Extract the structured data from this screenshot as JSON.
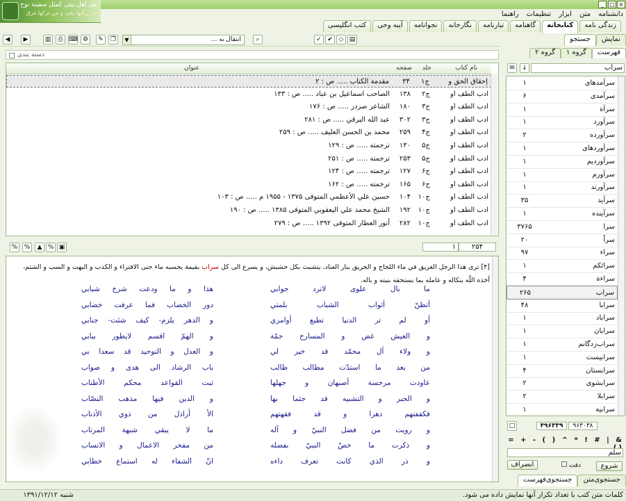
{
  "logo": {
    "line1": "مل اهل بیتی کمثل سفینة نوح",
    "line2": "من رکبها نجی و من",
    "line3": "ترکها غرق"
  },
  "menu": [
    "دانشنامه",
    "متن",
    "ابزار",
    "تنظیمات",
    "راهنما"
  ],
  "top_tabs": [
    "زندگی نامه",
    "کتابخانه",
    "گاهنامه",
    "تبارنامه",
    "نگارخانه",
    "نجوانامه",
    "آینه وحی",
    "کتب انگلیسی"
  ],
  "side_tabs": [
    "نمایش",
    "جستجو"
  ],
  "jump_label": "انتقال به ...",
  "category_label": "دسته بندی",
  "columns": {
    "book": "نام کتاب",
    "vol": "جلد",
    "page": "صفحه",
    "title": "عنوان"
  },
  "results": [
    {
      "book": "إحقاق الحق و ...",
      "vol": "ج۱",
      "page": "۳۴",
      "title": "مقدمة الكتاب ..... ص : ۲"
    },
    {
      "book": "ادب الطف أو ...",
      "vol": "ج۲",
      "page": "۱۳۸",
      "title": "الصاحب اسماعيل بن عباد ..... ص : ۱۳۳"
    },
    {
      "book": "ادب الطف أو ...",
      "vol": "ج۳",
      "page": "۱۸۰",
      "title": "الشاعر صردر ..... ص : ۱۷۶"
    },
    {
      "book": "ادب الطف أو ...",
      "vol": "ج۳",
      "page": "۳۰۲",
      "title": "عبد الله البرقي ..... ص : ۲۸۱"
    },
    {
      "book": "ادب الطف أو ...",
      "vol": "ج۴",
      "page": "۲۵۹",
      "title": "محمد بن الحسن العليف ..... ص : ۲۵۹"
    },
    {
      "book": "ادب الطف أو ...",
      "vol": "ج۵",
      "page": "۱۳۰",
      "title": "ترجمته ..... ص : ۱۲۹"
    },
    {
      "book": "ادب الطف أو ...",
      "vol": "ج۵",
      "page": "۲۵۳",
      "title": "ترجمته ..... ص : ۲۵۱"
    },
    {
      "book": "ادب الطف أو ...",
      "vol": "ج۶",
      "page": "۱۲۷",
      "title": "ترجمته ..... ص : ۱۲۴"
    },
    {
      "book": "ادب الطف أو ...",
      "vol": "ج۶",
      "page": "۱۶۵",
      "title": "ترجمته ..... ص : ۱۶۲"
    },
    {
      "book": "ادب الطف أو ...",
      "vol": "ج۱۰",
      "page": "۱۰۴",
      "title": "حسين علي الأعظمي المتوفى ۱۳۷۵ - ۱۹۵۵ م ..... ص : ۱۰۳"
    },
    {
      "book": "ادب الطف أو ...",
      "vol": "ج۱۰",
      "page": "۱۹۲",
      "title": "الشيخ محمد علي اليعقوبي المتوفى ۱۳۸۵ ..... ص : ۱۹۰"
    },
    {
      "book": "ادب الطف أو ...",
      "vol": "ج۱۰",
      "page": "۲۸۲",
      "title": "أنور العطار المتوفى ۱۳۹۲ ..... ص : ۲۷۹"
    }
  ],
  "pager": {
    "current": "۱",
    "total": "۲۵۴"
  },
  "prose": {
    "before": "[۴] ترى هذا الرجل الغريق في ماء اللجاج و الحريق بنار العناد، يتشبث بكل حشيش، و يسرع الى كل ",
    "highlight": "سراب",
    "after": " بقيمة يحسبه ماء حتى الافتراء و الكذب و البهت و السب و الشتم، أخذه اللّه بنكاله و عامله بما يستحقه بنيته و باله."
  },
  "poem": [
    [
      "ما بال علوى لاترد جوابي",
      "هذا و ما ودعت شرخ شبابي"
    ],
    [
      "أتظنّ أثواب الشباب بلمتي",
      "دور الخضاب فما عرفت خضابي"
    ],
    [
      "أو لم تر الدنيا تطيع أوامري",
      "و الدهر يلزم- كيف شئت- جنابي"
    ],
    [
      "و العيش غض و المسارح جمّة",
      "و الهمّ اقسم لايطور ببابي"
    ],
    [
      "و ولاء آل محمّد قد خير لي",
      "و العدل و التوحيد قد سعدا بي"
    ],
    [
      "من بعد ما استدّت مطالب طالب",
      "باب الرشاد الى هدى و صواب"
    ],
    [
      "عاودت مرجسة أصبهان و جهلها",
      "ثبت القواعد محكم الأطناب"
    ],
    [
      "و الجبر و التشبيه قد جثما بها",
      "و الدين فيها مذهب النصّاب"
    ],
    [
      "فكففتهم دهرا و قد فقهتهم",
      "الأ أراذل من ذوي الأذناب"
    ],
    [
      "و رويت من فضل النبيّ و آله",
      "ما لا يبقي شبهة المرتاب"
    ],
    [
      "و ذكرت ما خصّ النبيّ بفضله",
      "من مفخر الاعمال و الانساب"
    ],
    [
      "و ذر الذي كانت تعرف داءه",
      "انّ الشفاء له استماع خطابي"
    ]
  ],
  "group_tabs": [
    "فهرست",
    "گروه ۱",
    "گروه ۲"
  ],
  "search_value": "سراب",
  "words": [
    {
      "t": "سرآمدهای",
      "c": "۱"
    },
    {
      "t": "سرآمدی",
      "c": "۶"
    },
    {
      "t": "سرآة",
      "c": "۱"
    },
    {
      "t": "سرآورد",
      "c": "۱"
    },
    {
      "t": "سرآورده",
      "c": "۲"
    },
    {
      "t": "سرآوردهای",
      "c": "۱"
    },
    {
      "t": "سرآوردیم",
      "c": "۱"
    },
    {
      "t": "سرآورم",
      "c": "۱"
    },
    {
      "t": "سرآورند",
      "c": "۱"
    },
    {
      "t": "سرآید",
      "c": "۳۵"
    },
    {
      "t": "سرآینده",
      "c": "۱"
    },
    {
      "t": "سرا",
      "c": "۳۷۶۵"
    },
    {
      "t": "سراً",
      "c": "۲۰"
    },
    {
      "t": "سراء",
      "c": "۹۷"
    },
    {
      "t": "سرائكم",
      "c": "۱"
    },
    {
      "t": "سراءة",
      "c": "۴"
    },
    {
      "t": "سراب",
      "c": "۲۶۵"
    },
    {
      "t": "سرابا",
      "c": "۴۸"
    },
    {
      "t": "سراباد",
      "c": "۱"
    },
    {
      "t": "سرابان",
      "c": "۱"
    },
    {
      "t": "سراب‌زدگانم",
      "c": "۱"
    },
    {
      "t": "سرابیست",
      "c": "۱"
    },
    {
      "t": "سرابستان",
      "c": "۴"
    },
    {
      "t": "سرابشوی",
      "c": "۲"
    },
    {
      "t": "سرابلا",
      "c": "۲"
    },
    {
      "t": "سرابیة",
      "c": "۱"
    }
  ],
  "counts": {
    "a": "۹۶۳۰۳۸",
    "b": "۴۹۶۳۳۹"
  },
  "operators": "= + - ( ) ^ * ! # | & ()",
  "query": "سلم",
  "buttons": {
    "start": "شروع",
    "exact": "دقت",
    "cancel": "انصراف"
  },
  "bottom_tabs": [
    "جستجوی‌متن",
    "جستجوی‌فهرست"
  ],
  "status": {
    "message": "کلمات متن کتب با تعداد تکرار آنها نمایش داده می شود.",
    "date": "۱۳۹۱/۱۲/۱۲",
    "day": "شنبه"
  }
}
